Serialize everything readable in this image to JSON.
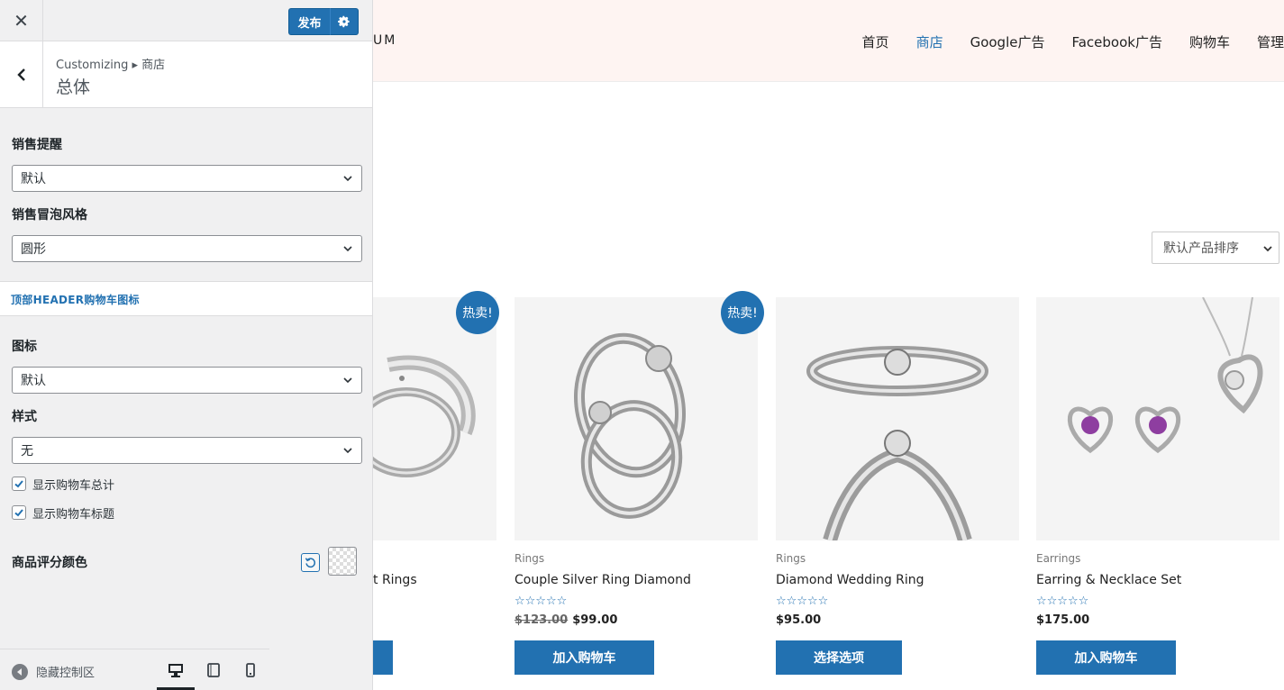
{
  "topbar": {
    "close_glyph": "✕",
    "publish_label": "发布"
  },
  "section": {
    "breadcrumb": "Customizing ▸ 商店",
    "title": "总体"
  },
  "controls": {
    "sale_notice_label": "销售提醒",
    "sale_notice_value": "默认",
    "sale_bubble_label": "销售冒泡风格",
    "sale_bubble_value": "圆形",
    "cart_section_title": "顶部HEADER购物车图标",
    "icon_label": "图标",
    "icon_value": "默认",
    "style_label": "样式",
    "style_value": "无",
    "show_cart_total_label": "显示购物车总计",
    "show_cart_total_checked": true,
    "show_cart_title_label": "显示购物车标题",
    "show_cart_title_checked": true,
    "rating_color_label": "商品评分颜色"
  },
  "footer": {
    "hide_controls_label": "隐藏控制区",
    "devices": [
      "desktop-icon",
      "tablet-icon",
      "mobile-icon"
    ],
    "active_device": "desktop"
  },
  "site": {
    "logo_fragment": "UM",
    "nav": [
      "首页",
      "商店",
      "Google广告",
      "Facebook广告",
      "购物车",
      "管理"
    ],
    "nav_active": "商店",
    "sort_value": "默认产品排序"
  },
  "products": [
    {
      "category": "",
      "title": "t Rings",
      "stars": "☆☆☆☆☆",
      "old_price": "",
      "price": "",
      "button": "",
      "badge": "热卖!"
    },
    {
      "category": "Rings",
      "title": "Couple Silver Ring Diamond",
      "stars": "☆☆☆☆☆",
      "old_price": "$123.00",
      "price": "$99.00",
      "button": "加入购物车",
      "badge": "热卖!"
    },
    {
      "category": "Rings",
      "title": "Diamond Wedding Ring",
      "stars": "☆☆☆☆☆",
      "old_price": "",
      "price": "$95.00",
      "button": "选择选项",
      "badge": ""
    },
    {
      "category": "Earrings",
      "title": "Earring & Necklace Set",
      "stars": "☆☆☆☆☆",
      "old_price": "",
      "price": "$175.00",
      "button": "加入购物车",
      "badge": ""
    }
  ],
  "colors": {
    "accent": "#2271b1",
    "header_bg": "#fef4f2",
    "sidebar_bg": "#f0f0f1"
  }
}
